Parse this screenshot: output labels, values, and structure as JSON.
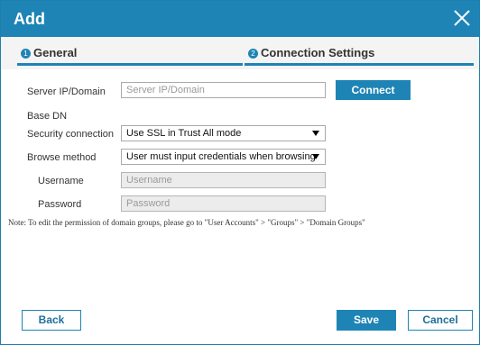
{
  "dialog": {
    "title": "Add",
    "close_icon": "close-icon"
  },
  "tabs": [
    {
      "number": "1",
      "label": "General",
      "active": true
    },
    {
      "number": "2",
      "label": "Connection Settings",
      "active": false
    }
  ],
  "form": {
    "server": {
      "label": "Server IP/Domain",
      "placeholder": "Server IP/Domain",
      "value": ""
    },
    "connect_label": "Connect",
    "base_dn_label": "Base DN",
    "security": {
      "label": "Security connection",
      "value": "Use SSL in Trust All mode"
    },
    "browse": {
      "label": "Browse method",
      "value": "User must input credentials when browsing"
    },
    "username": {
      "label": "Username",
      "placeholder": "Username"
    },
    "password": {
      "label": "Password",
      "placeholder": "Password"
    }
  },
  "note": "Note: To edit the permission of domain groups, please go to \"User Accounts\" > \"Groups\" > \"Domain Groups\"",
  "footer": {
    "back_label": "Back",
    "save_label": "Save",
    "cancel_label": "Cancel"
  },
  "colors": {
    "accent": "#1e84b5",
    "tab_bar": "#1e84b5"
  }
}
